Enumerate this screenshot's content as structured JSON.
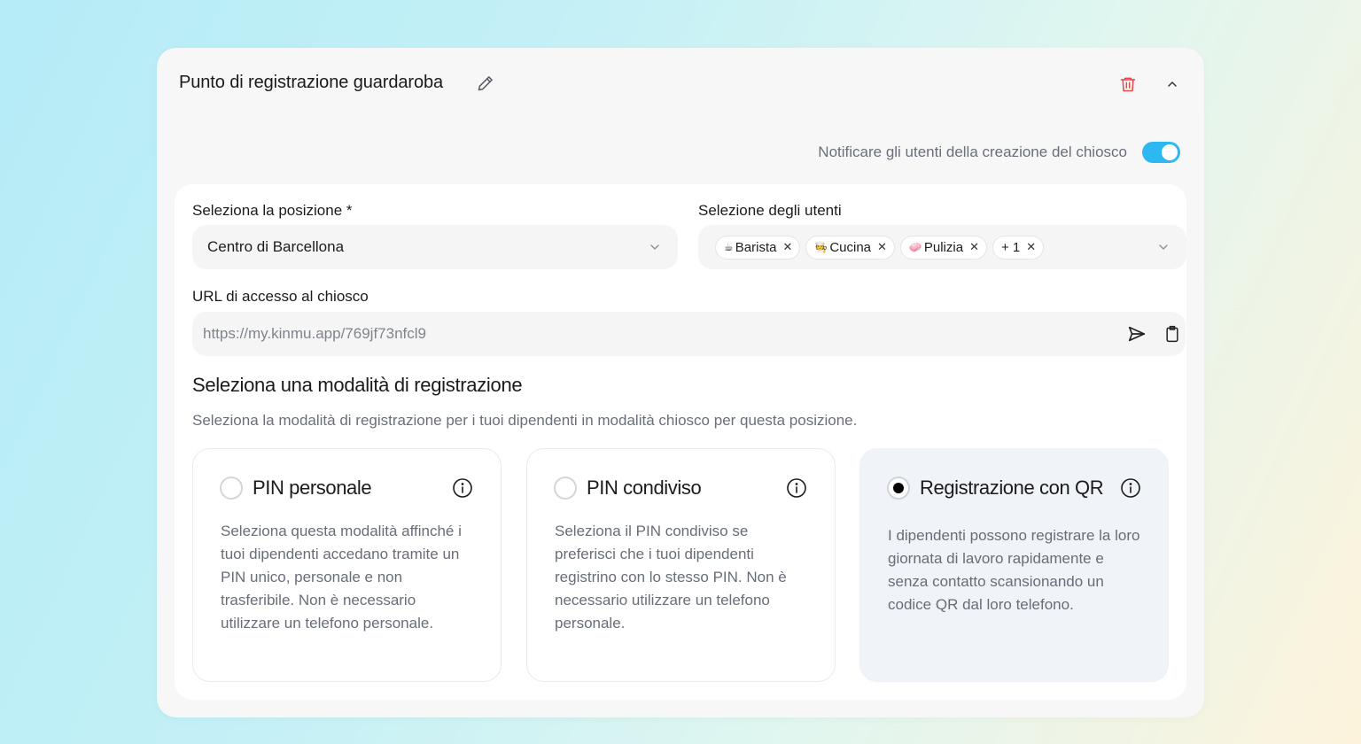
{
  "card": {
    "title": "Punto di registrazione guardaroba",
    "notify_label": "Notificare gli utenti della creazione del chiosco",
    "notify_enabled": true
  },
  "position": {
    "label": "Seleziona la posizione *",
    "value": "Centro di Barcellona"
  },
  "users": {
    "label": "Selezione degli utenti",
    "chips": [
      {
        "emoji": "☕",
        "label": "Barista"
      },
      {
        "emoji": "🧑‍🍳",
        "label": "Cucina"
      },
      {
        "emoji": "🧼",
        "label": "Pulizia"
      },
      {
        "emoji": "",
        "label": "+ 1"
      }
    ]
  },
  "url": {
    "label": "URL di accesso al chiosco",
    "value": "https://my.kinmu.app/769jf73nfcl9"
  },
  "mode": {
    "title": "Seleziona una modalità di registrazione",
    "description": "Seleziona la modalità di registrazione per i tuoi dipendenti in modalità chiosco per questa posizione.",
    "options": [
      {
        "title": "PIN personale",
        "description": "Seleziona questa modalità affinché i tuoi dipendenti accedano tramite un PIN unico, personale e non trasferibile. Non è necessario utilizzare un telefono personale.",
        "selected": false
      },
      {
        "title": "PIN condiviso",
        "description": "Seleziona il PIN condiviso se preferisci che i tuoi dipendenti registrino con lo stesso PIN. Non è necessario utilizzare un telefono personale.",
        "selected": false
      },
      {
        "title": "Registrazione con QR",
        "description": "I dipendenti possono registrare la loro giornata di lavoro rapidamente e senza contatto scansionando un codice QR dal loro telefono.",
        "selected": true
      }
    ]
  },
  "colors": {
    "accent": "#2eb8f2",
    "danger": "#e5484d"
  }
}
